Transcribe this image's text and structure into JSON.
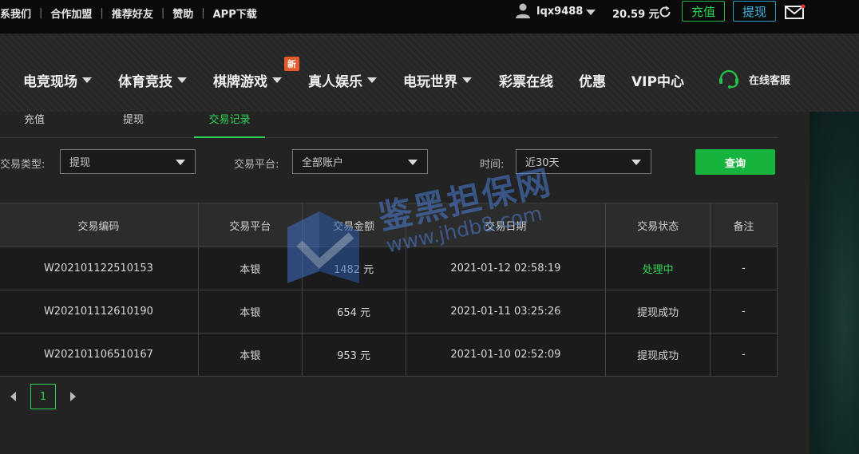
{
  "topbar": {
    "links": [
      "系我们",
      "合作加盟",
      "推荐好友",
      "赞助",
      "APP下载"
    ],
    "username": "lqx9488",
    "balance": "20.59 元",
    "deposit_label": "充值",
    "withdraw_label": "提现"
  },
  "nav": {
    "items": [
      "电竞现场",
      "体育竞技",
      "棋牌游戏",
      "真人娱乐",
      "电玩世界",
      "彩票在线",
      "优惠",
      "VIP中心"
    ],
    "new_badge": "新",
    "support_label": "在线客服"
  },
  "tabs": [
    "充值",
    "提现",
    "交易记录"
  ],
  "filters": {
    "type_label": "交易类型:",
    "type_value": "提现",
    "platform_label": "交易平台:",
    "platform_value": "全部账户",
    "time_label": "时间:",
    "time_value": "近30天",
    "query_label": "查询"
  },
  "table": {
    "headers": [
      "交易编码",
      "交易平台",
      "交易金额",
      "交易日期",
      "交易状态",
      "备注"
    ],
    "rows": [
      [
        "W202101122510153",
        "本银",
        "1482 元",
        "2021-01-12 02:58:19",
        "处理中",
        "-"
      ],
      [
        "W202101112610190",
        "本银",
        "654 元",
        "2021-01-11 03:25:26",
        "提现成功",
        "-"
      ],
      [
        "W202101106510167",
        "本银",
        "953 元",
        "2021-01-10 02:52:09",
        "提现成功",
        "-"
      ]
    ]
  },
  "pagination": {
    "current": "1"
  },
  "watermark": {
    "title": "鉴黑担保网",
    "url": "www.jhdb8.com"
  },
  "colors": {
    "accent_green": "#2bd452",
    "deposit_border": "#27b34a",
    "withdraw_border": "#2b9fc7",
    "new_badge": "#e55a2b",
    "query_button": "#16b43c"
  }
}
